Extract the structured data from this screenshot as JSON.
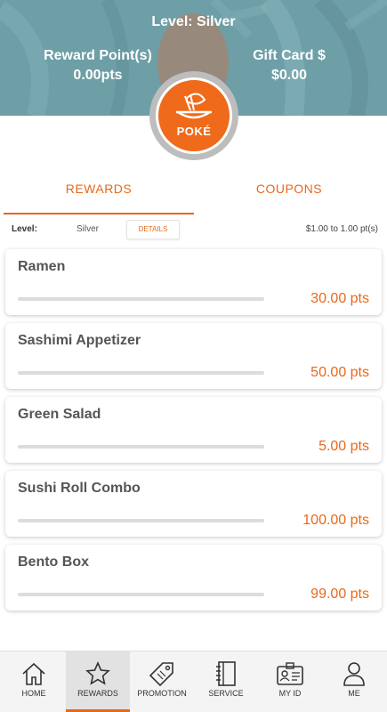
{
  "header": {
    "level_title": "Level: Silver",
    "reward_points_label": "Reward Point(s)",
    "reward_points_value": "0.00pts",
    "gift_card_label": "Gift Card $",
    "gift_card_value": "$0.00",
    "logo_text": "POKÉ",
    "background_color": "#6e9ea6"
  },
  "tabs": [
    {
      "label": "REWARDS",
      "active": true
    },
    {
      "label": "COUPONS",
      "active": false
    }
  ],
  "level_row": {
    "label": "Level:",
    "value": "Silver",
    "details_label": "DETAILS",
    "rate": "$1.00 to 1.00 pt(s)"
  },
  "rewards": [
    {
      "name": "Ramen",
      "points": "30.00 pts",
      "progress": 0
    },
    {
      "name": "Sashimi Appetizer",
      "points": "50.00 pts",
      "progress": 0
    },
    {
      "name": "Green Salad",
      "points": "5.00 pts",
      "progress": 0
    },
    {
      "name": "Sushi Roll Combo",
      "points": "100.00 pts",
      "progress": 0
    },
    {
      "name": "Bento Box",
      "points": "99.00 pts",
      "progress": 0
    }
  ],
  "nav": [
    {
      "label": "HOME",
      "icon": "home-icon",
      "active": false
    },
    {
      "label": "REWARDS",
      "icon": "star-icon",
      "active": true
    },
    {
      "label": "PROMOTION",
      "icon": "tag-icon",
      "active": false
    },
    {
      "label": "SERVICE",
      "icon": "notebook-icon",
      "active": false
    },
    {
      "label": "MY ID",
      "icon": "id-card-icon",
      "active": false
    },
    {
      "label": "ME",
      "icon": "person-icon",
      "active": false
    }
  ],
  "colors": {
    "accent": "#e8681a",
    "text": "#555555"
  }
}
